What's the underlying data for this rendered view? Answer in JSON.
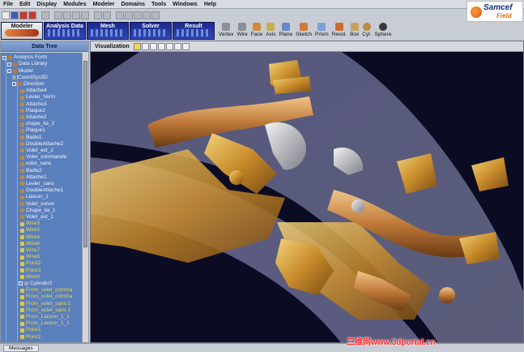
{
  "menu": [
    "File",
    "Edit",
    "Display",
    "Modules",
    "Modeler",
    "Domains",
    "Tools",
    "Windows",
    "Help"
  ],
  "brand": {
    "name": "Samcef",
    "sub": "Field"
  },
  "modules": [
    "Modeler",
    "Analysis Data",
    "Mesh",
    "Solver",
    "Result"
  ],
  "geometry_tools": [
    "Vertex",
    "Wire",
    "Face",
    "Axis",
    "Plane",
    "Sketch",
    "Prism",
    "Revol.",
    "Box",
    "Cyl.",
    "Sphere"
  ],
  "tree": {
    "title": "Data Tree",
    "items": [
      {
        "label": "Analysis Form",
        "kind": "folder"
      },
      {
        "label": "Data Library",
        "kind": "folder"
      },
      {
        "label": "Model",
        "kind": "folder"
      },
      {
        "label": "CoordSys3D",
        "kind": "gray"
      },
      {
        "label": "Direction",
        "kind": "folder"
      },
      {
        "label": "Attache4",
        "kind": "part"
      },
      {
        "label": "Levier_Verin",
        "kind": "part"
      },
      {
        "label": "Attache3",
        "kind": "part"
      },
      {
        "label": "Plaque2",
        "kind": "part"
      },
      {
        "label": "Attache2",
        "kind": "part"
      },
      {
        "label": "chape_lia_2",
        "kind": "part"
      },
      {
        "label": "Plaque1",
        "kind": "part"
      },
      {
        "label": "Bielle1",
        "kind": "part"
      },
      {
        "label": "DoubleAttache2",
        "kind": "part"
      },
      {
        "label": "Volet_ext_2",
        "kind": "part"
      },
      {
        "label": "Volet_commande",
        "kind": "part"
      },
      {
        "label": "volet_sans",
        "kind": "part"
      },
      {
        "label": "Bielle2",
        "kind": "part"
      },
      {
        "label": "Attache1",
        "kind": "part"
      },
      {
        "label": "Levier_sans",
        "kind": "part"
      },
      {
        "label": "DoubleAttache1",
        "kind": "part"
      },
      {
        "label": "Liaison_1",
        "kind": "part"
      },
      {
        "label": "Volet_suiver",
        "kind": "part"
      },
      {
        "label": "Chape_lia_1",
        "kind": "part"
      },
      {
        "label": "Volet_ext_1",
        "kind": "part"
      },
      {
        "label": "Wire3",
        "kind": "wire"
      },
      {
        "label": "Wire5",
        "kind": "wire"
      },
      {
        "label": "Wire4",
        "kind": "wire"
      },
      {
        "label": "Wire6",
        "kind": "wire"
      },
      {
        "label": "Wire7",
        "kind": "wire"
      },
      {
        "label": "Wire8",
        "kind": "wire"
      },
      {
        "label": "Point2",
        "kind": "wire"
      },
      {
        "label": "Point3",
        "kind": "wire"
      },
      {
        "label": "Wire9",
        "kind": "wire"
      },
      {
        "label": "Cylinder2",
        "kind": "gray"
      },
      {
        "label": "From_volet_comma",
        "kind": "wire"
      },
      {
        "label": "From_volet_comma",
        "kind": "wire"
      },
      {
        "label": "From_volet_sans 1",
        "kind": "wire"
      },
      {
        "label": "From_volet_sans 2",
        "kind": "wire"
      },
      {
        "label": "From_Liaison_1_1",
        "kind": "wire"
      },
      {
        "label": "From_Liaison_1_1",
        "kind": "wire"
      },
      {
        "label": "Point1",
        "kind": "wire"
      },
      {
        "label": "Point2",
        "kind": "wire"
      }
    ]
  },
  "visualization": {
    "title": "Visualization"
  },
  "status": {
    "messages_tab": "Messages"
  },
  "watermark": "三维网www.3dportal.cn",
  "colors": {
    "scene_bg": "#0b0c24",
    "part_gold": "#d9a441",
    "tree_bg": "#5a7fbd",
    "module_blue": "#1c2a8e"
  }
}
